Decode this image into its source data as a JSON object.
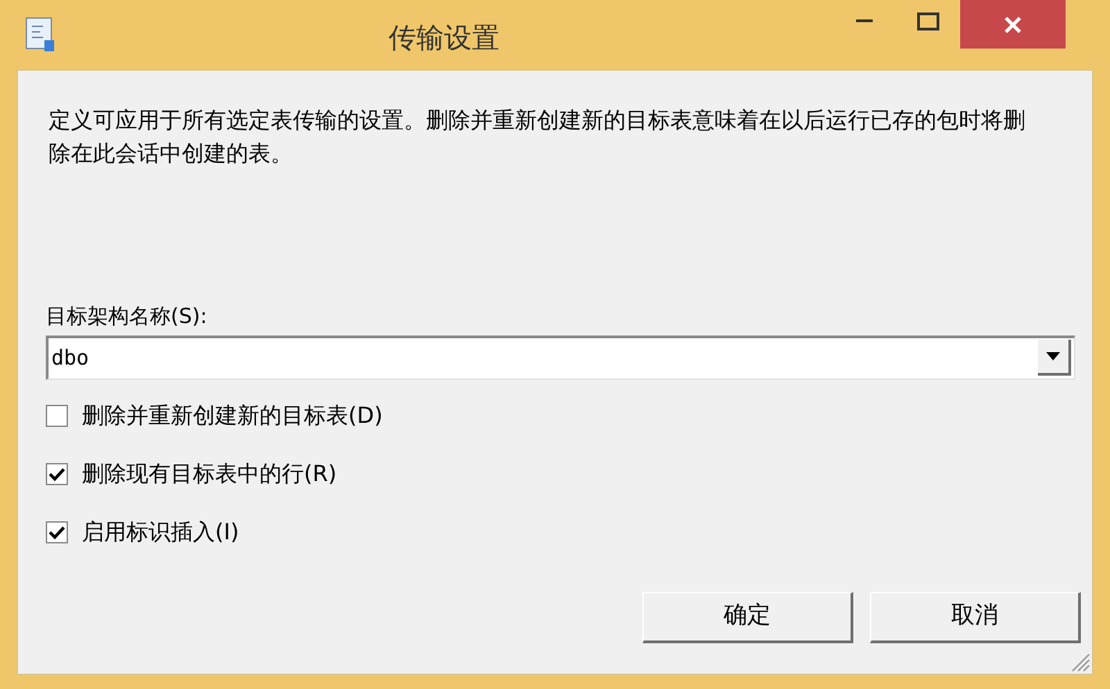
{
  "window": {
    "title": "传输设置"
  },
  "description": "定义可应用于所有选定表传输的设置。删除并重新创建新的目标表意味着在以后运行已存的包时将删除在此会话中创建的表。",
  "schema": {
    "label": "目标架构名称(S):",
    "value": "dbo"
  },
  "options": [
    {
      "label": "删除并重新创建新的目标表(D)",
      "checked": false
    },
    {
      "label": "删除现有目标表中的行(R)",
      "checked": true
    },
    {
      "label": "启用标识插入(I)",
      "checked": true
    }
  ],
  "buttons": [
    "确定",
    "取消"
  ]
}
